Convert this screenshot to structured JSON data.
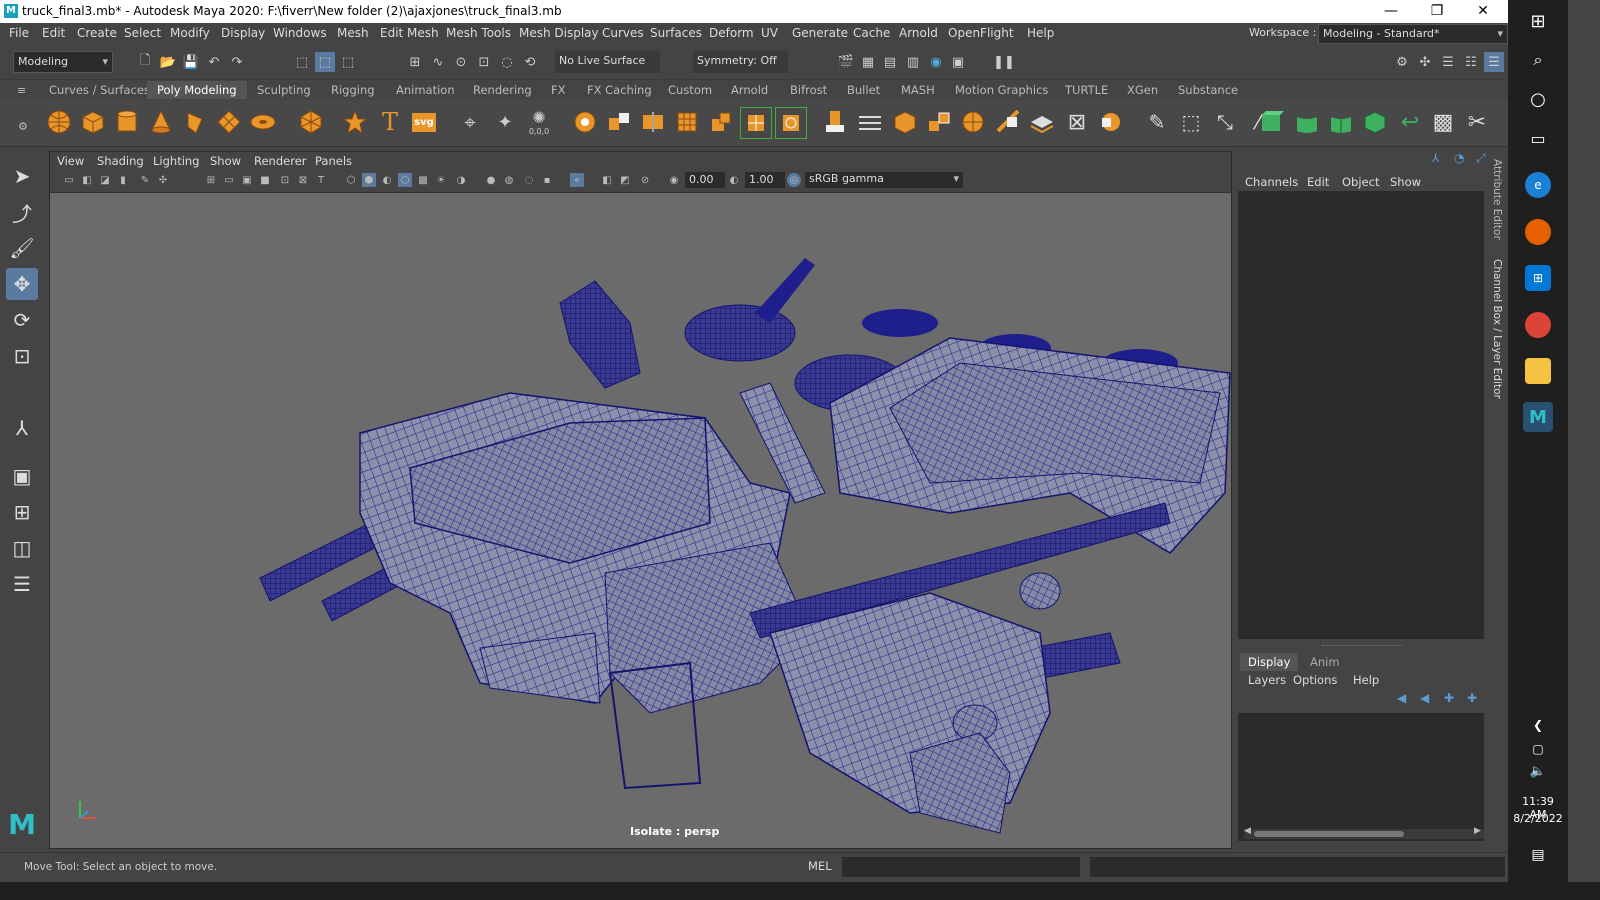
{
  "window": {
    "title": "truck_final3.mb* - Autodesk Maya 2020: F:\\fiverr\\New folder (2)\\ajaxjones\\truck_final3.mb",
    "minimize": "—",
    "maximize": "❐",
    "close": "✕"
  },
  "menubar": {
    "items": [
      "File",
      "Edit",
      "Create",
      "Select",
      "Modify",
      "Display",
      "Windows",
      "Mesh",
      "Edit Mesh",
      "Mesh Tools",
      "Mesh Display",
      "Curves",
      "Surfaces",
      "Deform",
      "UV",
      "Generate",
      "Cache",
      "Arnold",
      "OpenFlight",
      "Help"
    ],
    "workspace_label": "Workspace :",
    "workspace_value": "Modeling - Standard*"
  },
  "statusline": {
    "menuset": "Modeling",
    "live_surface": "No Live Surface",
    "symmetry": "Symmetry: Off"
  },
  "shelf": {
    "tabs": [
      "Curves / Surfaces",
      "Poly Modeling",
      "Sculpting",
      "Rigging",
      "Animation",
      "Rendering",
      "FX",
      "FX Caching",
      "Custom",
      "Arnold",
      "Bifrost",
      "Bullet",
      "MASH",
      "Motion Graphics",
      "TURTLE",
      "XGen",
      "Substance"
    ],
    "active_tab": "Poly Modeling",
    "text_icons": {
      "text_tool": "T",
      "svg_tool": "svg",
      "snap_value": "0,0,0"
    }
  },
  "viewport": {
    "menus": [
      "View",
      "Shading",
      "Lighting",
      "Show",
      "Renderer",
      "Panels"
    ],
    "exposure": "0.00",
    "gamma": "1.00",
    "color_space": "sRGB gamma",
    "hud_label": "Isolate : persp"
  },
  "channelbox": {
    "menus": [
      "Channels",
      "Edit",
      "Object",
      "Show"
    ],
    "layer_tabs": [
      "Display",
      "Anim"
    ],
    "layer_menus": [
      "Layers",
      "Options",
      "Help"
    ],
    "side_tabs": [
      "Attribute Editor",
      "Channel Box / Layer Editor"
    ]
  },
  "helpline": {
    "message": "Move Tool: Select an object to move.",
    "command_lang": "MEL"
  },
  "taskbar": {
    "time": "11:39 AM",
    "date": "8/2/2022"
  },
  "colors": {
    "wireframe": "#1e1e8c",
    "mesh_fill": "#8a8fa8",
    "viewport_bg": "#6b6b6b",
    "ui_bg": "#444444",
    "shelf_icon_orange": "#e8962a"
  }
}
